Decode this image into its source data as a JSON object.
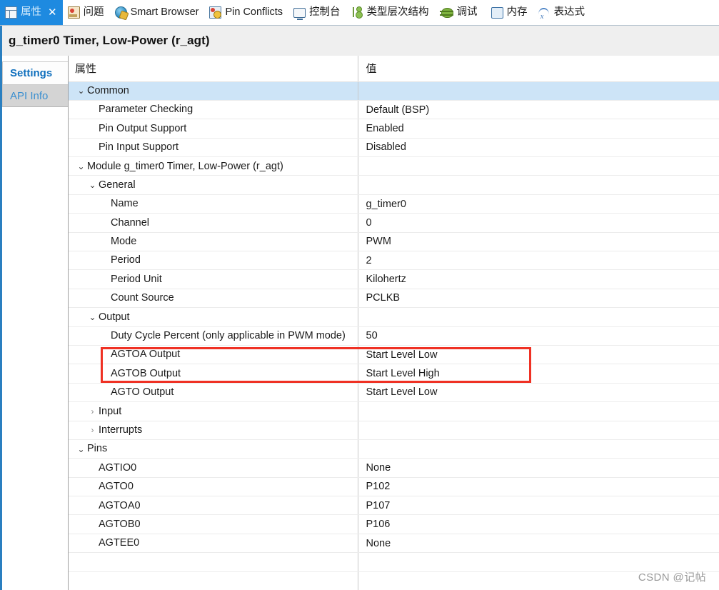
{
  "window": {
    "title": "g_timer0 Timer, Low-Power (r_agt)"
  },
  "tabbar": {
    "tabs": [
      {
        "label": "属性",
        "icon": "properties-grid-icon",
        "active": true,
        "close": "✕"
      },
      {
        "label": "问题",
        "icon": "problems-marker-icon",
        "active": false
      },
      {
        "label": "Smart Browser",
        "icon": "globe-icon",
        "active": false
      },
      {
        "label": "Pin Conflicts",
        "icon": "pin-conflict-icon",
        "active": false
      },
      {
        "label": "控制台",
        "icon": "console-icon",
        "active": false
      },
      {
        "label": "类型层次结构",
        "icon": "type-hierarchy-icon",
        "active": false
      },
      {
        "label": "调试",
        "icon": "bug-icon",
        "active": false
      },
      {
        "label": "内存",
        "icon": "memory-icon",
        "active": false
      },
      {
        "label": "表达式",
        "icon": "expression-icon",
        "active": false
      }
    ]
  },
  "sidebar": {
    "items": [
      {
        "label": "Settings",
        "selected": true
      },
      {
        "label": "API Info",
        "selected": false
      }
    ]
  },
  "table": {
    "headers": {
      "property": "属性",
      "value": "值"
    },
    "rows": [
      {
        "indent": 0,
        "twisty": "expanded",
        "property": "Common",
        "value": "",
        "selected": true
      },
      {
        "indent": 1,
        "twisty": "none",
        "property": "Parameter Checking",
        "value": "Default (BSP)"
      },
      {
        "indent": 1,
        "twisty": "none",
        "property": "Pin Output Support",
        "value": "Enabled"
      },
      {
        "indent": 1,
        "twisty": "none",
        "property": "Pin Input Support",
        "value": "Disabled"
      },
      {
        "indent": 0,
        "twisty": "expanded",
        "property": "Module g_timer0 Timer, Low-Power (r_agt)",
        "value": ""
      },
      {
        "indent": 1,
        "twisty": "expanded",
        "property": "General",
        "value": ""
      },
      {
        "indent": 2,
        "twisty": "none",
        "property": "Name",
        "value": "g_timer0"
      },
      {
        "indent": 2,
        "twisty": "none",
        "property": "Channel",
        "value": "0"
      },
      {
        "indent": 2,
        "twisty": "none",
        "property": "Mode",
        "value": "PWM"
      },
      {
        "indent": 2,
        "twisty": "none",
        "property": "Period",
        "value": "2"
      },
      {
        "indent": 2,
        "twisty": "none",
        "property": "Period Unit",
        "value": "Kilohertz"
      },
      {
        "indent": 2,
        "twisty": "none",
        "property": "Count Source",
        "value": "PCLKB"
      },
      {
        "indent": 1,
        "twisty": "expanded",
        "property": "Output",
        "value": ""
      },
      {
        "indent": 2,
        "twisty": "none",
        "property": "Duty Cycle Percent (only applicable in PWM mode)",
        "value": "50"
      },
      {
        "indent": 2,
        "twisty": "none",
        "property": "AGTOA Output",
        "value": "Start Level Low"
      },
      {
        "indent": 2,
        "twisty": "none",
        "property": "AGTOB Output",
        "value": "Start Level High"
      },
      {
        "indent": 2,
        "twisty": "none",
        "property": "AGTO Output",
        "value": "Start Level Low"
      },
      {
        "indent": 1,
        "twisty": "collapsed",
        "property": "Input",
        "value": ""
      },
      {
        "indent": 1,
        "twisty": "collapsed",
        "property": "Interrupts",
        "value": ""
      },
      {
        "indent": 0,
        "twisty": "expanded",
        "property": "Pins",
        "value": ""
      },
      {
        "indent": 1,
        "twisty": "none",
        "property": "AGTIO0",
        "value": "None"
      },
      {
        "indent": 1,
        "twisty": "none",
        "property": "AGTO0",
        "value": "P102"
      },
      {
        "indent": 1,
        "twisty": "none",
        "property": "AGTOA0",
        "value": "P107"
      },
      {
        "indent": 1,
        "twisty": "none",
        "property": "AGTOB0",
        "value": "P106"
      },
      {
        "indent": 1,
        "twisty": "none",
        "property": "AGTEE0",
        "value": "None"
      },
      {
        "indent": 0,
        "twisty": "none",
        "property": "",
        "value": ""
      },
      {
        "indent": 0,
        "twisty": "none",
        "property": "",
        "value": ""
      }
    ]
  },
  "annotation": {
    "highlight_color": "#ef3124",
    "highlighted_rows": [
      "AGTOA Output",
      "AGTOB Output"
    ]
  },
  "watermark": {
    "text": "CSDN @记帖"
  },
  "glyphs": {
    "expanded": "⌄",
    "collapsed": "›"
  }
}
